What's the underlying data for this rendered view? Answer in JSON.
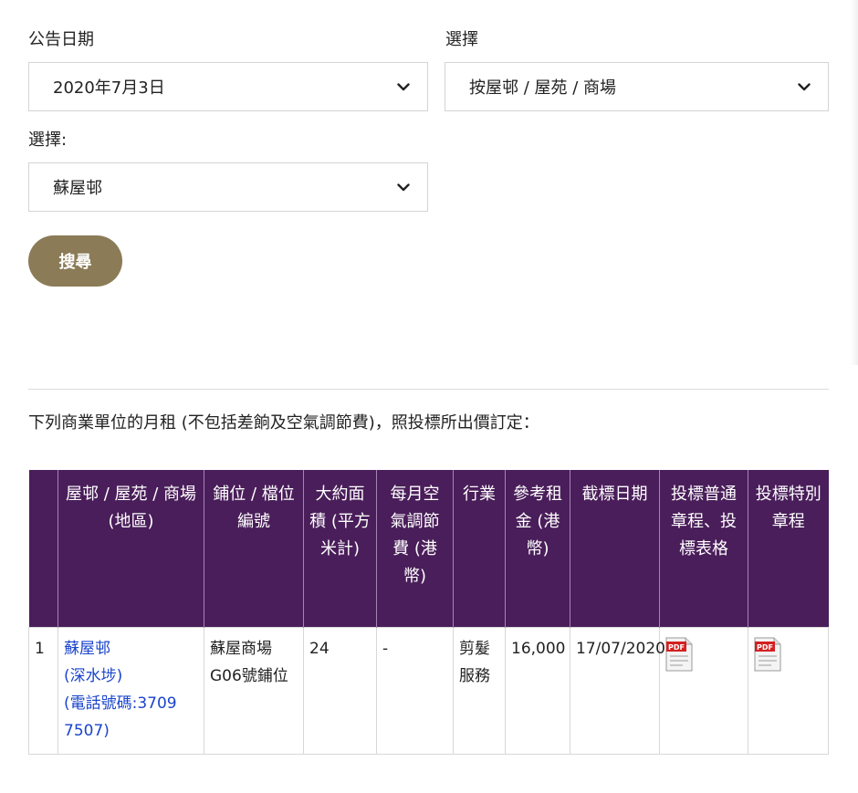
{
  "filters": {
    "date_label": "公告日期",
    "date_value": "2020年7月3日",
    "select_type_label": "選擇",
    "select_type_value": "按屋邨 / 屋苑 / 商場",
    "select_estate_label": "選擇:",
    "select_estate_value": "蘇屋邨",
    "search_label": "搜尋"
  },
  "intro_text": "下列商業單位的月租 (不包括差餉及空氣調節費)，照投標所出價訂定：",
  "table": {
    "headers": [
      "",
      "屋邨 / 屋苑 / 商場 (地區)",
      "鋪位 / 檔位編號",
      "大約面積 (平方米計)",
      "每月空氣調節費 (港幣)",
      "行業",
      "參考租金 (港幣)",
      "截標日期",
      "投標普通章程、投標表格",
      "投標特別章程"
    ],
    "rows": [
      {
        "no": "1",
        "estate_name": "蘇屋邨",
        "estate_district": "(深水埗)",
        "estate_phone": "(電話號碼:3709 7507)",
        "shop_no": "蘇屋商場G06號鋪位",
        "area": "24",
        "ac_fee": "-",
        "trade": "剪髮服務",
        "rent": "16,000",
        "closing_date": "17/07/2020",
        "general_doc_icon": "pdf-icon",
        "special_doc_icon": "pdf-icon"
      }
    ]
  },
  "colors": {
    "header_bg": "#4a1e5a",
    "button_bg": "#8b7b57",
    "link": "#1a44cc"
  }
}
